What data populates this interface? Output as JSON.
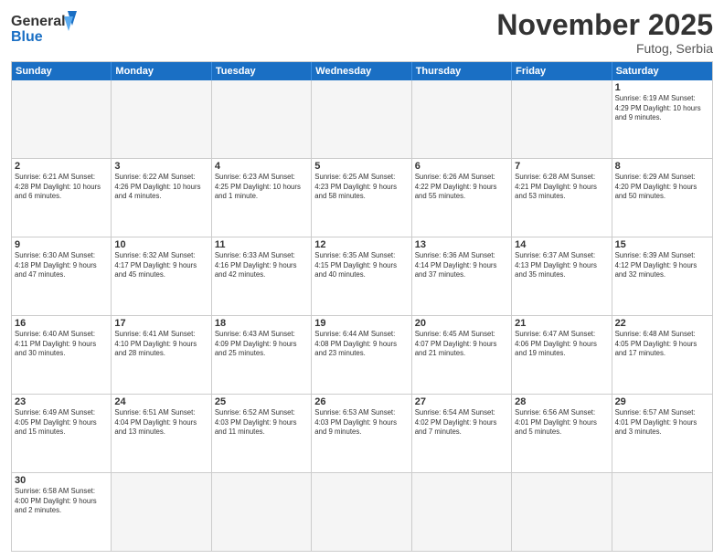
{
  "header": {
    "logo_general": "General",
    "logo_blue": "Blue",
    "month_title": "November 2025",
    "location": "Futog, Serbia"
  },
  "weekdays": [
    "Sunday",
    "Monday",
    "Tuesday",
    "Wednesday",
    "Thursday",
    "Friday",
    "Saturday"
  ],
  "weeks": [
    [
      {
        "day": "",
        "info": ""
      },
      {
        "day": "",
        "info": ""
      },
      {
        "day": "",
        "info": ""
      },
      {
        "day": "",
        "info": ""
      },
      {
        "day": "",
        "info": ""
      },
      {
        "day": "",
        "info": ""
      },
      {
        "day": "1",
        "info": "Sunrise: 6:19 AM\nSunset: 4:29 PM\nDaylight: 10 hours and 9 minutes."
      }
    ],
    [
      {
        "day": "2",
        "info": "Sunrise: 6:21 AM\nSunset: 4:28 PM\nDaylight: 10 hours and 6 minutes."
      },
      {
        "day": "3",
        "info": "Sunrise: 6:22 AM\nSunset: 4:26 PM\nDaylight: 10 hours and 4 minutes."
      },
      {
        "day": "4",
        "info": "Sunrise: 6:23 AM\nSunset: 4:25 PM\nDaylight: 10 hours and 1 minute."
      },
      {
        "day": "5",
        "info": "Sunrise: 6:25 AM\nSunset: 4:23 PM\nDaylight: 9 hours and 58 minutes."
      },
      {
        "day": "6",
        "info": "Sunrise: 6:26 AM\nSunset: 4:22 PM\nDaylight: 9 hours and 55 minutes."
      },
      {
        "day": "7",
        "info": "Sunrise: 6:28 AM\nSunset: 4:21 PM\nDaylight: 9 hours and 53 minutes."
      },
      {
        "day": "8",
        "info": "Sunrise: 6:29 AM\nSunset: 4:20 PM\nDaylight: 9 hours and 50 minutes."
      }
    ],
    [
      {
        "day": "9",
        "info": "Sunrise: 6:30 AM\nSunset: 4:18 PM\nDaylight: 9 hours and 47 minutes."
      },
      {
        "day": "10",
        "info": "Sunrise: 6:32 AM\nSunset: 4:17 PM\nDaylight: 9 hours and 45 minutes."
      },
      {
        "day": "11",
        "info": "Sunrise: 6:33 AM\nSunset: 4:16 PM\nDaylight: 9 hours and 42 minutes."
      },
      {
        "day": "12",
        "info": "Sunrise: 6:35 AM\nSunset: 4:15 PM\nDaylight: 9 hours and 40 minutes."
      },
      {
        "day": "13",
        "info": "Sunrise: 6:36 AM\nSunset: 4:14 PM\nDaylight: 9 hours and 37 minutes."
      },
      {
        "day": "14",
        "info": "Sunrise: 6:37 AM\nSunset: 4:13 PM\nDaylight: 9 hours and 35 minutes."
      },
      {
        "day": "15",
        "info": "Sunrise: 6:39 AM\nSunset: 4:12 PM\nDaylight: 9 hours and 32 minutes."
      }
    ],
    [
      {
        "day": "16",
        "info": "Sunrise: 6:40 AM\nSunset: 4:11 PM\nDaylight: 9 hours and 30 minutes."
      },
      {
        "day": "17",
        "info": "Sunrise: 6:41 AM\nSunset: 4:10 PM\nDaylight: 9 hours and 28 minutes."
      },
      {
        "day": "18",
        "info": "Sunrise: 6:43 AM\nSunset: 4:09 PM\nDaylight: 9 hours and 25 minutes."
      },
      {
        "day": "19",
        "info": "Sunrise: 6:44 AM\nSunset: 4:08 PM\nDaylight: 9 hours and 23 minutes."
      },
      {
        "day": "20",
        "info": "Sunrise: 6:45 AM\nSunset: 4:07 PM\nDaylight: 9 hours and 21 minutes."
      },
      {
        "day": "21",
        "info": "Sunrise: 6:47 AM\nSunset: 4:06 PM\nDaylight: 9 hours and 19 minutes."
      },
      {
        "day": "22",
        "info": "Sunrise: 6:48 AM\nSunset: 4:05 PM\nDaylight: 9 hours and 17 minutes."
      }
    ],
    [
      {
        "day": "23",
        "info": "Sunrise: 6:49 AM\nSunset: 4:05 PM\nDaylight: 9 hours and 15 minutes."
      },
      {
        "day": "24",
        "info": "Sunrise: 6:51 AM\nSunset: 4:04 PM\nDaylight: 9 hours and 13 minutes."
      },
      {
        "day": "25",
        "info": "Sunrise: 6:52 AM\nSunset: 4:03 PM\nDaylight: 9 hours and 11 minutes."
      },
      {
        "day": "26",
        "info": "Sunrise: 6:53 AM\nSunset: 4:03 PM\nDaylight: 9 hours and 9 minutes."
      },
      {
        "day": "27",
        "info": "Sunrise: 6:54 AM\nSunset: 4:02 PM\nDaylight: 9 hours and 7 minutes."
      },
      {
        "day": "28",
        "info": "Sunrise: 6:56 AM\nSunset: 4:01 PM\nDaylight: 9 hours and 5 minutes."
      },
      {
        "day": "29",
        "info": "Sunrise: 6:57 AM\nSunset: 4:01 PM\nDaylight: 9 hours and 3 minutes."
      }
    ],
    [
      {
        "day": "30",
        "info": "Sunrise: 6:58 AM\nSunset: 4:00 PM\nDaylight: 9 hours and 2 minutes."
      },
      {
        "day": "",
        "info": ""
      },
      {
        "day": "",
        "info": ""
      },
      {
        "day": "",
        "info": ""
      },
      {
        "day": "",
        "info": ""
      },
      {
        "day": "",
        "info": ""
      },
      {
        "day": "",
        "info": ""
      }
    ]
  ]
}
